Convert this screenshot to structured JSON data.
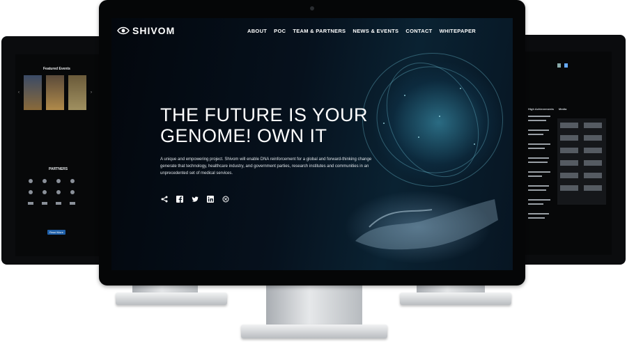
{
  "brand": {
    "name": "SHIVOM"
  },
  "nav": {
    "items": [
      "ABOUT",
      "POC",
      "TEAM & PARTNERS",
      "NEWS & EVENTS",
      "CONTACT",
      "WHITEPAPER"
    ]
  },
  "hero": {
    "title_line1": "THE FUTURE IS YOUR",
    "title_line2": "GENOME! OWN IT",
    "description": "A unique and empowering project. Shivom will enable DNA reinforcement for a global and forward-thinking change generate that technology, healthcare industry, and government parties, research institutes and communities in an unprecedented set of medical services."
  },
  "social": {
    "icons": [
      "share-icon",
      "facebook-icon",
      "twitter-icon",
      "linkedin-icon",
      "globe-icon"
    ]
  },
  "left_screen": {
    "title": "Featured Events",
    "partners_title": "PARTNERS",
    "button": "Read More"
  },
  "right_screen": {
    "col1_title": "High Achievements",
    "col2_title": "Media"
  },
  "colors": {
    "background": "#ffffff",
    "screen_dark": "#06111d",
    "accent_teal": "#46aac8",
    "text": "#ffffff"
  }
}
